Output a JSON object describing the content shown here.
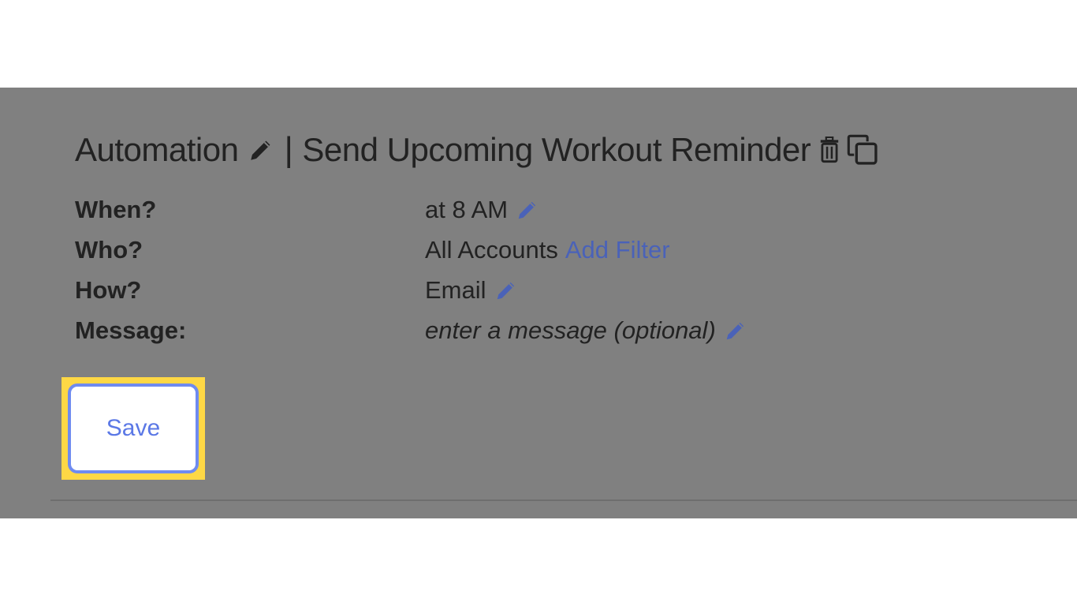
{
  "header": {
    "section_label": "Automation",
    "separator": "|",
    "automation_name": "Send Upcoming Workout Reminder",
    "icons": {
      "edit": "pencil-icon",
      "delete": "trash-icon",
      "copy": "copy-icon"
    }
  },
  "details": {
    "when": {
      "label": "When?",
      "value": "at 8 AM"
    },
    "who": {
      "label": "Who?",
      "value": "All Accounts",
      "link": "Add Filter"
    },
    "how": {
      "label": "How?",
      "value": "Email"
    },
    "message": {
      "label": "Message:",
      "placeholder": "enter a message (optional)"
    }
  },
  "actions": {
    "save_label": "Save"
  },
  "colors": {
    "overlay": "#808080",
    "link": "#4a62b8",
    "button_border": "#6f8bf0",
    "highlight": "#fed845"
  }
}
